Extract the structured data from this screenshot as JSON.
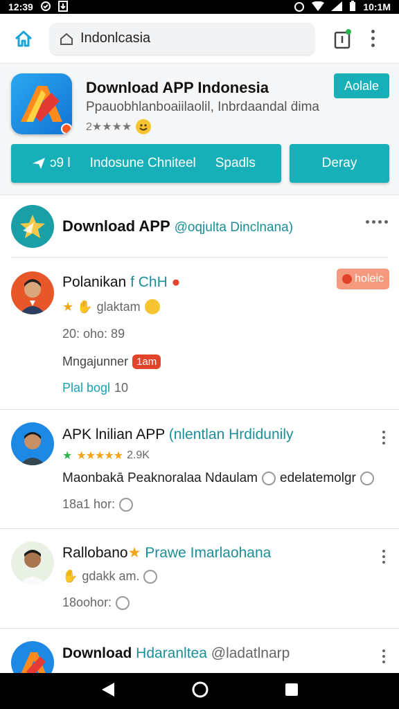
{
  "status_bar": {
    "time_left": "12:39",
    "time_right": "10:1M"
  },
  "browser": {
    "url": "Indonlcasia"
  },
  "app_card": {
    "title": "Download APP Indonesia",
    "subtitle": "Ppauobhlanboaiilaolil, Inbrdaandal ḋima",
    "rating_text": "2★★★★",
    "add_label": "Aolale",
    "share_count": "ɔ9 Ɩ",
    "channel_label": "Indosune Chniteel",
    "spacer_label": "Spadls",
    "download_label": "Deray"
  },
  "feed_header": {
    "title": "Download APP",
    "handle": "@oqjulta Dinclnana)"
  },
  "posts": [
    {
      "name": "Polanikan",
      "name_accent": "f ChH",
      "follow_label": "holeic",
      "meta": "glaktam",
      "time": "20: oho: 89",
      "tag_text": "Mngajunner",
      "tag_badge": "1am",
      "link_text": "Plal bogl",
      "link_count": "10"
    },
    {
      "name": "APK lnilian APP",
      "name_accent": "(nlentlan Hrdidunily",
      "rating": "★★★★★",
      "rating_count": "2.9K",
      "body": "Maonbakā Peaknoralaa Ndaulam",
      "body_accent": "edelatemolgr",
      "time": "18a1 hor:"
    },
    {
      "name": "Rallobano",
      "name_accent": "Prawe Imarlaohana",
      "meta": "gdakk am.",
      "time": "18oohor:"
    },
    {
      "name": "Download",
      "name_accent": "Hdaranltea",
      "tail": "@ladatlnarp"
    }
  ],
  "colors": {
    "teal": "#17b0b8",
    "accent_text": "#1b8f97",
    "red_badge": "#e2432b",
    "follow_pill": "#f59a7f"
  }
}
